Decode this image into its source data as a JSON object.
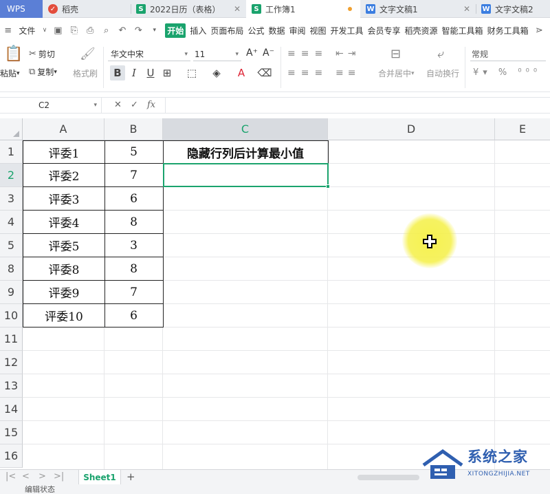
{
  "tabs": [
    {
      "label": "WPS"
    },
    {
      "label": "稻壳"
    },
    {
      "label": "2022日历（表格）"
    },
    {
      "label": "工作簿1"
    },
    {
      "label": "文字文稿1"
    },
    {
      "label": "文字文稿2"
    }
  ],
  "menu": {
    "file": "文件",
    "items": [
      "开始",
      "插入",
      "页面布局",
      "公式",
      "数据",
      "审阅",
      "视图",
      "开发工具",
      "会员专享",
      "稻壳资源",
      "智能工具箱",
      "财务工具箱"
    ]
  },
  "ribbon": {
    "paste": "粘贴",
    "cut": "剪切",
    "copy": "复制",
    "format_painter": "格式刷",
    "font_name": "华文中宋",
    "font_size": "11",
    "merge_center": "合并居中",
    "auto_wrap": "自动换行",
    "number_format": "常规"
  },
  "formula_bar": {
    "name_box": "C2",
    "fx": "fx",
    "formula": ""
  },
  "columns": [
    "A",
    "B",
    "C",
    "D",
    "E"
  ],
  "rows": [
    "1",
    "2",
    "3",
    "4",
    "5",
    "8",
    "9",
    "10",
    "11",
    "12",
    "13",
    "14",
    "15",
    "16"
  ],
  "cells": {
    "A": [
      "评委1",
      "评委2",
      "评委3",
      "评委4",
      "评委5",
      "评委8",
      "评委9",
      "评委10"
    ],
    "B": [
      "5",
      "7",
      "6",
      "8",
      "3",
      "8",
      "7",
      "6"
    ],
    "C1": "隐藏行列后计算最小值"
  },
  "active_cell": "C2",
  "sheet": {
    "name": "Sheet1"
  },
  "status": "编辑状态",
  "watermark": {
    "title": "系统之家",
    "url": "XITONGZHIJIA.NET"
  },
  "colors": {
    "accent": "#1aa36d",
    "highlight": "#f5f046",
    "wps_tab": "#5b7fd6"
  }
}
